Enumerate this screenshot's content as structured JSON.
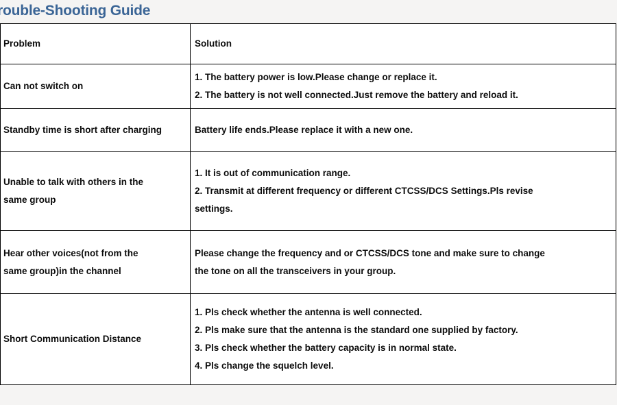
{
  "title": "rouble-Shooting Guide",
  "table": {
    "headers": {
      "problem": "Problem",
      "solution": "Solution"
    },
    "rows": [
      {
        "problem_lines": [
          "Can not switch on"
        ],
        "solution_lines": [
          "1. The battery power is low.Please change or replace it.",
          "2. The battery is not well connected.Just remove the battery and reload it."
        ]
      },
      {
        "problem_lines": [
          "Standby time is short after charging"
        ],
        "solution_lines": [
          "Battery life ends.Please replace it with a new one."
        ]
      },
      {
        "problem_lines": [
          "Unable to talk with others in the",
          "same group"
        ],
        "solution_lines": [
          "1. It is out of communication range.",
          "2. Transmit at different frequency or different CTCSS/DCS Settings.Pls revise",
          "settings."
        ]
      },
      {
        "problem_lines": [
          "Hear other voices(not from the",
          "same group)in the channel"
        ],
        "solution_lines": [
          "Please change the frequency and or CTCSS/DCS tone and make sure to change",
          "the tone on all the transceivers in your group."
        ]
      },
      {
        "problem_lines": [
          "Short Communication Distance"
        ],
        "solution_lines": [
          "1. Pls check whether the antenna is well connected.",
          "2. Pls make sure that the antenna is the standard one supplied by factory.",
          "3. Pls check whether the battery capacity is in normal state.",
          "4. Pls change the squelch level."
        ]
      }
    ]
  },
  "colors": {
    "title": "#3b6596",
    "text": "#0c0c0c",
    "border": "#000000",
    "page_background": "#f5f4f3",
    "table_background": "#ffffff"
  }
}
